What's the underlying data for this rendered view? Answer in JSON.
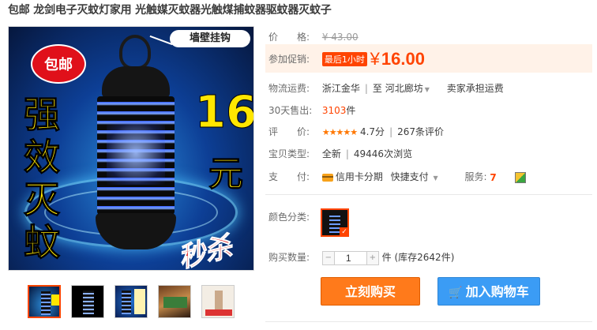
{
  "product": {
    "title": "包邮 龙剑电子灭蚊灯家用 光触媒灭蚊器光触煤捕蚊器驱蚊器灭蚊子"
  },
  "main_image": {
    "callout": "墙壁挂钩",
    "badge": "包邮",
    "vertical_text": "强效灭蚊",
    "price_big": "16",
    "price_unit": "元",
    "seckill": "秒杀"
  },
  "details": {
    "price_label": "价　　格:",
    "orig_price": "¥ 43.00",
    "promo_label": "参加促销:",
    "promo_tag": "最后1小时",
    "promo_currency": "¥",
    "promo_price": "16.00",
    "shipping_label": "物流运费:",
    "shipping_from": "浙江金华",
    "shipping_sep": "至",
    "shipping_to": "河北廊坊",
    "shipping_fee": "卖家承担运费",
    "sold_label": "30天售出:",
    "sold_count": "3103",
    "sold_unit": "件",
    "rating_label": "评　　价:",
    "rating_stars": "★★★★★",
    "rating_score": "4.7分",
    "rating_count": "267条评价",
    "type_label": "宝贝类型:",
    "type_value": "全新",
    "views": "49446次浏览",
    "pay_label": "支　　付:",
    "pay_credit": "信用卡分期",
    "pay_fast": "快捷支付",
    "service_label": "服务:",
    "service_seven": "7",
    "color_label": "颜色分类:",
    "qty_label": "购买数量:",
    "qty_value": "1",
    "qty_stock": "件 (库存2642件)"
  },
  "buttons": {
    "buy": "立刻购买",
    "cart": "加入购物车"
  },
  "colors": {
    "accent": "#ff4400",
    "buy_button": "#ff7a1b",
    "cart_button": "#3b9cf5"
  }
}
